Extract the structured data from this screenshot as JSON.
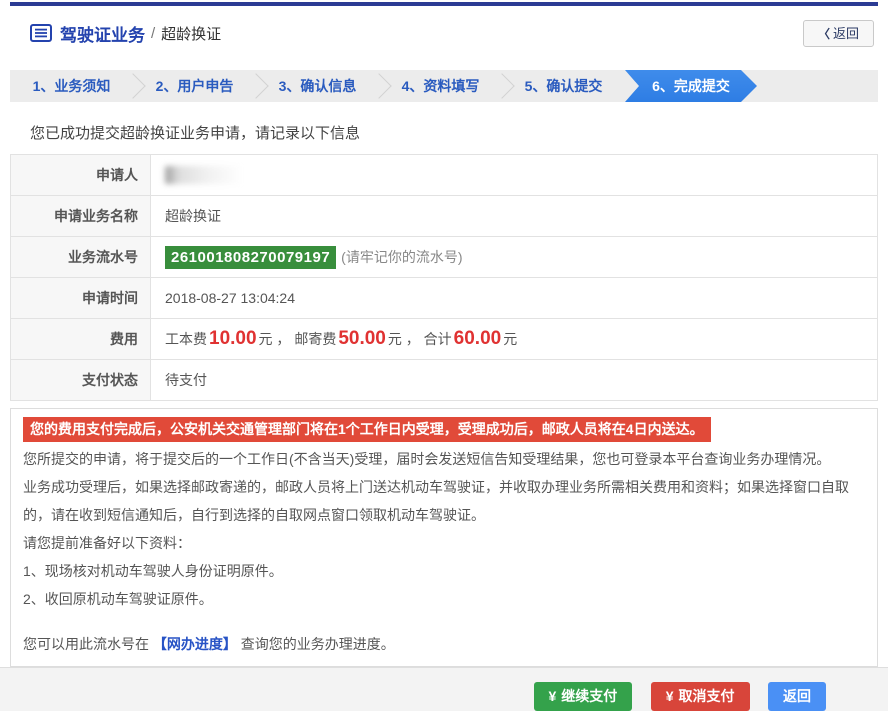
{
  "header": {
    "title_primary": "驾驶证业务",
    "title_separator": "/",
    "title_secondary": "超龄换证",
    "back_chevron": "〈",
    "back_label": "返回"
  },
  "steps": {
    "items": [
      {
        "label": "1、业务须知",
        "active": false
      },
      {
        "label": "2、用户申告",
        "active": false
      },
      {
        "label": "3、确认信息",
        "active": false
      },
      {
        "label": "4、资料填写",
        "active": false
      },
      {
        "label": "5、确认提交",
        "active": false
      },
      {
        "label": "6、完成提交",
        "active": true
      }
    ]
  },
  "main": {
    "success_message": "您已成功提交超龄换证业务申请，请记录以下信息",
    "info_table": {
      "applicant": {
        "label": "申请人",
        "value_redacted": true
      },
      "business_name": {
        "label": "申请业务名称",
        "value": "超龄换证"
      },
      "serial": {
        "label": "业务流水号",
        "number": "261001808270079197",
        "note": "(请牢记你的流水号)"
      },
      "apply_time": {
        "label": "申请时间",
        "value": "2018-08-27 13:04:24"
      },
      "fee": {
        "label": "费用",
        "parts": [
          "工本费 ",
          "10.00",
          "元 ， 邮寄费 ",
          "50.00",
          "元 ， 合计 ",
          "60.00",
          "元"
        ]
      },
      "pay_status": {
        "label": "支付状态",
        "value": "待支付"
      }
    },
    "alert_banner": "您的费用支付完成后，公安机关交通管理部门将在1个工作日内受理，受理成功后，邮政人员将在4日内送达。",
    "notes": [
      "您所提交的申请，将于提交后的一个工作日(不含当天)受理，届时会发送短信告知受理结果，您也可登录本平台查询业务办理情况。",
      "业务成功受理后，如果选择邮政寄递的，邮政人员将上门送达机动车驾驶证，并收取办理业务所需相关费用和资料；如果选择窗口自取的，请在收到短信通知后，自行到选择的自取网点窗口领取机动车驾驶证。",
      "请您提前准备好以下资料：",
      "1、现场核对机动车驾驶人身份证明原件。",
      "2、收回原机动车驾驶证原件。"
    ],
    "progress_line": {
      "prefix": "您可以用此流水号在 ",
      "link": "【网办进度】",
      "suffix": " 查询您的业务办理进度。"
    }
  },
  "footer": {
    "currency_symbol": "¥",
    "buttons": [
      {
        "label": "继续支付"
      },
      {
        "label": "取消支付"
      },
      {
        "label": "返回"
      }
    ]
  },
  "colors": {
    "top_bar": "#2b3b94",
    "brand_blue": "#2443ae",
    "step_text": "#2a5bbf",
    "step_active_bg": "#2e7de4",
    "serial_bg": "#388e3c",
    "price_red": "#e03232",
    "alert_bg": "#e14a39",
    "link_blue": "#2753c5",
    "btn_green": "#34a24b",
    "btn_red": "#d8453a",
    "btn_blue": "#4a90f5"
  }
}
